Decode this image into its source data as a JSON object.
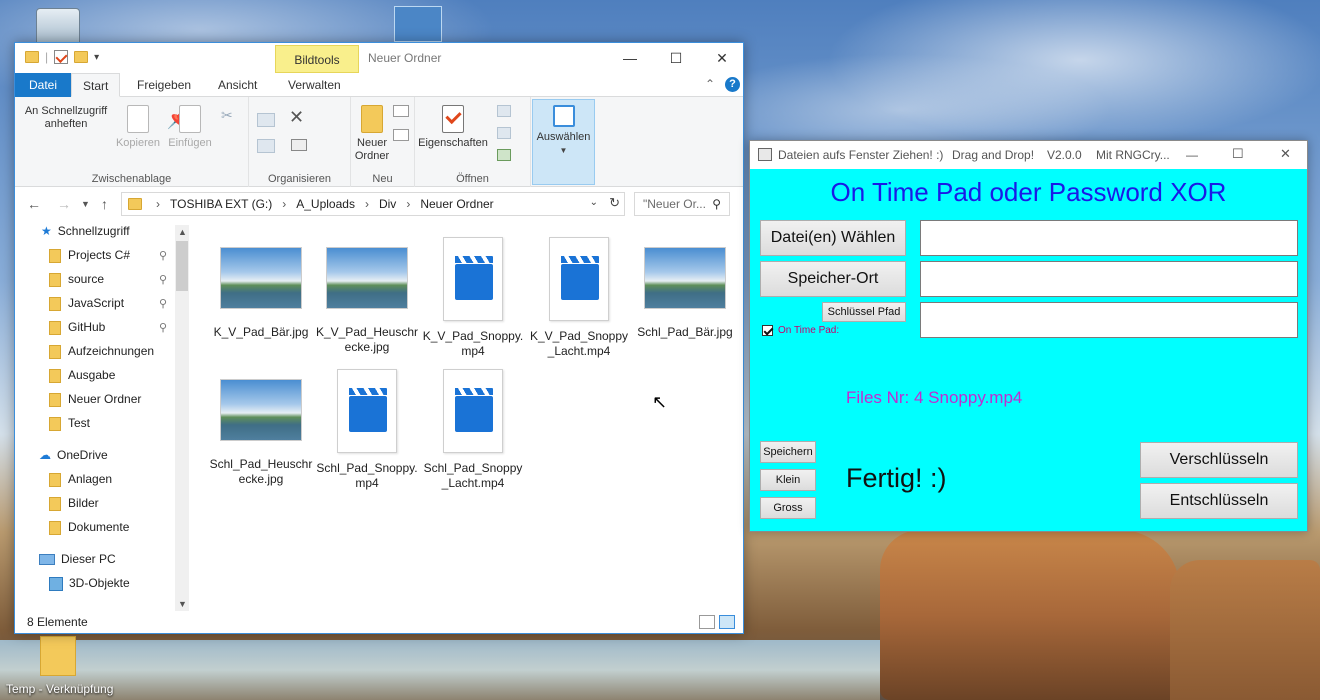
{
  "desktop": {
    "shortcut_label": "Temp - Verknüpfung"
  },
  "explorer": {
    "title": "Neuer Ordner",
    "bildtools": "Bildtools",
    "tabs": [
      "Datei",
      "Start",
      "Freigeben",
      "Ansicht",
      "Verwalten"
    ],
    "ribbon": {
      "pin_label": "An Schnellzugriff anheften",
      "copy_label": "Kopieren",
      "paste_label": "Einfügen",
      "group_clipboard": "Zwischenablage",
      "group_organize": "Organisieren",
      "new_folder_label": "Neuer Ordner",
      "group_new": "Neu",
      "properties_label": "Eigenschaften",
      "group_open": "Öffnen",
      "select_label": "Auswählen"
    },
    "address": {
      "crumbs": [
        "TOSHIBA EXT (G:)",
        "A_Uploads",
        "Div",
        "Neuer Ordner"
      ],
      "search_placeholder": "\"Neuer Or..."
    },
    "nav": {
      "quick_access": "Schnellzugriff",
      "quick_items": [
        "Projects C#",
        "source",
        "JavaScript",
        "GitHub",
        "Aufzeichnungen",
        "Ausgabe",
        "Neuer Ordner",
        "Test"
      ],
      "onedrive": "OneDrive",
      "onedrive_items": [
        "Anlagen",
        "Bilder",
        "Dokumente"
      ],
      "this_pc": "Dieser PC",
      "pc_items": [
        "3D-Objekte"
      ]
    },
    "files": [
      {
        "name": "K_V_Pad_Bär.jpg",
        "type": "image"
      },
      {
        "name": "K_V_Pad_Heuschrecke.jpg",
        "type": "image"
      },
      {
        "name": "K_V_Pad_Snoppy.mp4",
        "type": "video"
      },
      {
        "name": "K_V_Pad_Snoppy_Lacht.mp4",
        "type": "video"
      },
      {
        "name": "Schl_Pad_Bär.jpg",
        "type": "image"
      },
      {
        "name": "Schl_Pad_Heuschrecke.jpg",
        "type": "image"
      },
      {
        "name": "Schl_Pad_Snoppy.mp4",
        "type": "video"
      },
      {
        "name": "Schl_Pad_Snoppy_Lacht.mp4",
        "type": "video"
      }
    ],
    "status": "8 Elemente"
  },
  "xor_app": {
    "title_parts": [
      "Dateien aufs Fenster Ziehen! :)",
      "Drag and Drop!",
      "V2.0.0",
      "Mit RNGCry..."
    ],
    "heading": "On Time Pad oder Password XOR",
    "btn_choose": "Datei(en) Wählen",
    "btn_storage": "Speicher-Ort",
    "btn_key_path": "Schlüssel Pfad",
    "checkbox_label": "On Time Pad:",
    "checkbox_checked": true,
    "field_files": "",
    "field_storage": "",
    "field_key": "",
    "files_info": "Files Nr: 4  Snoppy.mp4",
    "btn_save": "Speichern",
    "btn_small": "Klein",
    "btn_large": "Gross",
    "status": "Fertig! :)",
    "btn_encrypt": "Verschlüsseln",
    "btn_decrypt": "Entschlüsseln",
    "bg_color": "#00ffff",
    "heading_color": "#1a1ae6",
    "info_color": "#c02bd2"
  }
}
